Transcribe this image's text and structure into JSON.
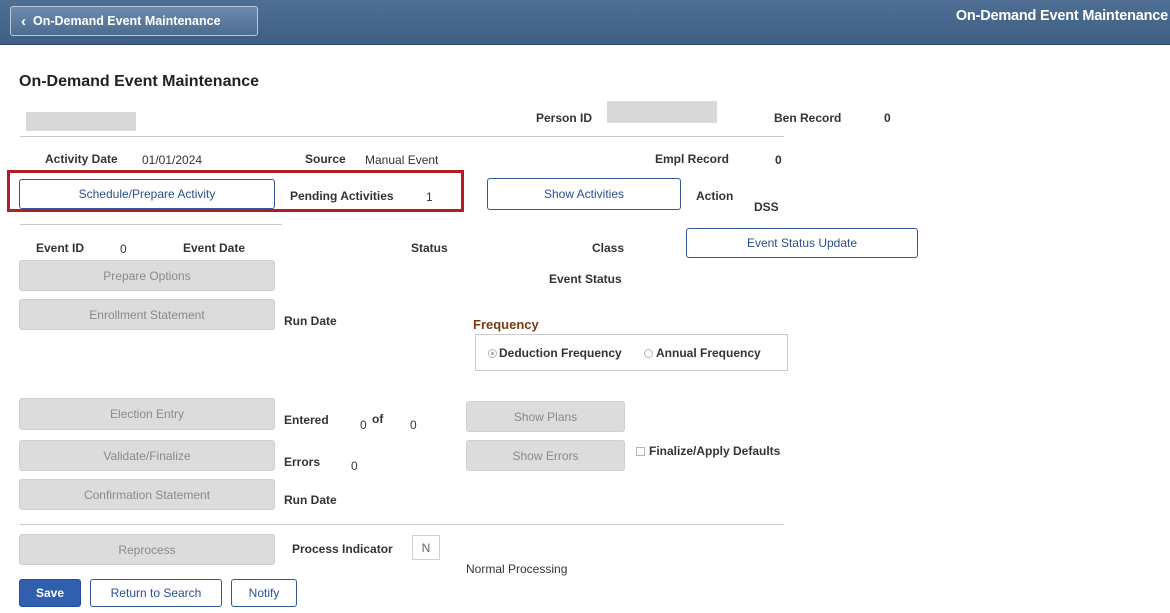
{
  "header": {
    "back_label": "On-Demand Event Maintenance",
    "title": "On-Demand Event Maintenance"
  },
  "page_title": "On-Demand Event Maintenance",
  "person": {
    "person_id_label": "Person ID",
    "ben_record_label": "Ben Record",
    "ben_record_value": "0"
  },
  "activity": {
    "date_label": "Activity Date",
    "date_value": "01/01/2024",
    "source_label": "Source",
    "source_value": "Manual Event",
    "empl_record_label": "Empl Record",
    "empl_record_value": "0",
    "schedule_button": "Schedule/Prepare Activity",
    "pending_label": "Pending Activities",
    "pending_value": "1",
    "show_activities_button": "Show Activities",
    "action_label": "Action",
    "action_value": "DSS"
  },
  "event": {
    "event_id_label": "Event ID",
    "event_id_value": "0",
    "event_date_label": "Event Date",
    "status_label": "Status",
    "class_label": "Class",
    "event_status_update_button": "Event Status Update",
    "event_status_label": "Event Status",
    "prepare_options_button": "Prepare Options",
    "enrollment_statement_button": "Enrollment Statement",
    "run_date_label": "Run Date"
  },
  "frequency": {
    "title": "Frequency",
    "option_deduction": "Deduction Frequency",
    "option_annual": "Annual Frequency",
    "selected": "Deduction Frequency"
  },
  "election": {
    "election_entry_button": "Election Entry",
    "entered_label": "Entered",
    "entered_value": "0",
    "of_label": "of",
    "of_value": "0",
    "show_plans_button": "Show Plans",
    "validate_button": "Validate/Finalize",
    "errors_label": "Errors",
    "errors_value": "0",
    "show_errors_button": "Show Errors",
    "finalize_defaults_label": "Finalize/Apply Defaults",
    "confirmation_button": "Confirmation Statement",
    "run_date_label": "Run Date"
  },
  "processing": {
    "reprocess_button": "Reprocess",
    "process_indicator_label": "Process Indicator",
    "process_indicator_value": "N",
    "normal_processing": "Normal Processing"
  },
  "footer": {
    "save_button": "Save",
    "return_button": "Return to Search",
    "notify_button": "Notify"
  },
  "colors": {
    "header_bg": "#4a6a8f",
    "highlight_border": "#b01e24",
    "primary_button": "#2f5fae",
    "frequency_title": "#7a3b16"
  }
}
